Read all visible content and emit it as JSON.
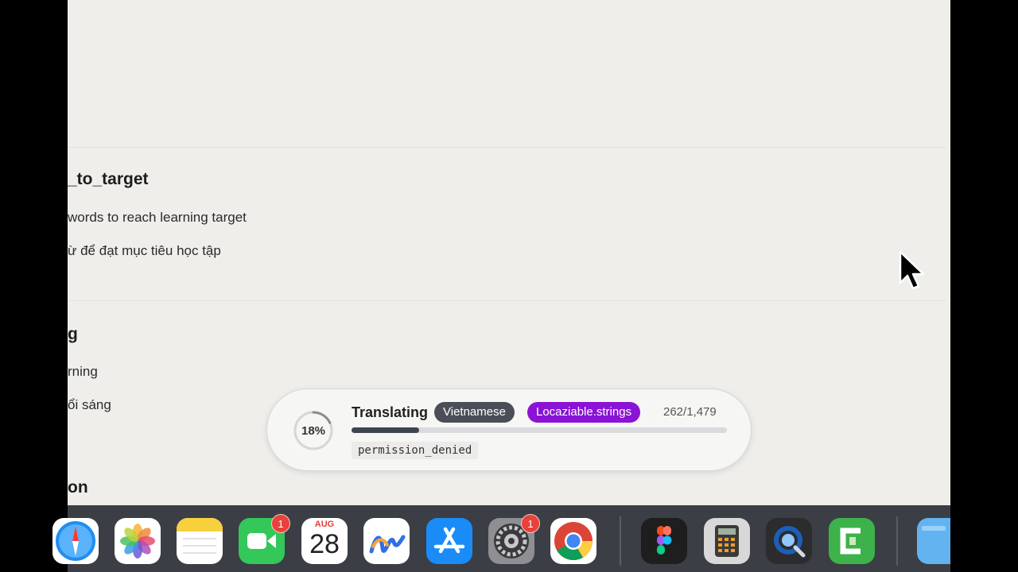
{
  "entries": [
    {
      "key": "_to_target",
      "source": "words to reach learning target",
      "translation": "ừ để đạt mục tiêu học tập"
    },
    {
      "key": "g",
      "source": "rning",
      "translation": "ổi sáng"
    },
    {
      "key": "on"
    }
  ],
  "translation_hud": {
    "percent": "18%",
    "progress_fraction": 0.18,
    "title": "Translating",
    "language": "Vietnamese",
    "file": "Locaziable.strings",
    "count": "262/1,479",
    "current_key": "permission_denied"
  },
  "dock": {
    "apps": [
      {
        "name": "safari-icon"
      },
      {
        "name": "photos-icon"
      },
      {
        "name": "notes-icon"
      },
      {
        "name": "facetime-icon",
        "badge": "1"
      },
      {
        "name": "calendar-icon",
        "month": "AUG",
        "day": "28"
      },
      {
        "name": "freeform-icon"
      },
      {
        "name": "app-store-icon"
      },
      {
        "name": "system-settings-icon",
        "badge": "1"
      },
      {
        "name": "chrome-icon"
      },
      {
        "name": "figma-icon"
      },
      {
        "name": "calculator-icon"
      },
      {
        "name": "quicktime-icon"
      },
      {
        "name": "camtasia-icon"
      },
      {
        "name": "folder-icon"
      }
    ]
  },
  "colors": {
    "accent_purple": "#8a13d6",
    "language_pill": "#4a4f57",
    "badge_red": "#e8423a"
  }
}
